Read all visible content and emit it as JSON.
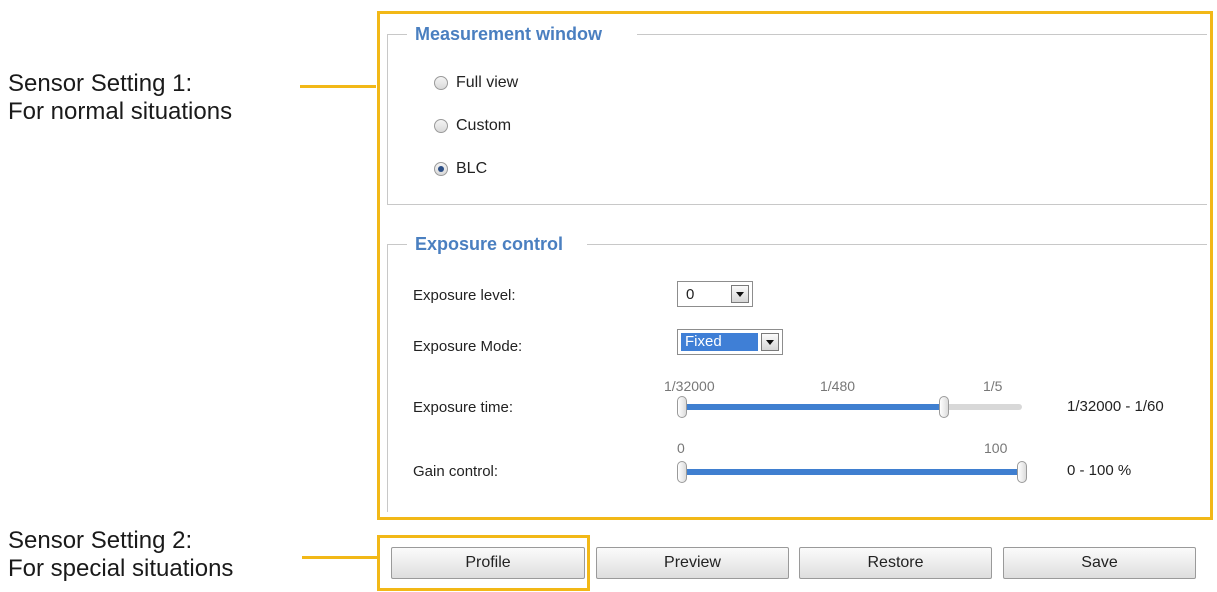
{
  "annotations": {
    "setting1_line1": "Sensor Setting 1:",
    "setting1_line2": "For normal situations",
    "setting2_line1": "Sensor Setting 2:",
    "setting2_line2": "For special situations"
  },
  "measurement_window": {
    "title": "Measurement window",
    "options": [
      {
        "label": "Full view",
        "checked": false
      },
      {
        "label": "Custom",
        "checked": false
      },
      {
        "label": "BLC",
        "checked": true
      }
    ]
  },
  "exposure_control": {
    "title": "Exposure control",
    "exposure_level": {
      "label": "Exposure level:",
      "value": "0"
    },
    "exposure_mode": {
      "label": "Exposure Mode:",
      "value": "Fixed"
    },
    "exposure_time": {
      "label": "Exposure time:",
      "ticks": [
        "1/32000",
        "1/480",
        "1/5"
      ],
      "range_text": "1/32000 - 1/60",
      "low_fraction": 0.0,
      "high_fraction": 0.77
    },
    "gain_control": {
      "label": "Gain control:",
      "ticks": [
        "0",
        "100"
      ],
      "range_text": "0 - 100 %",
      "low_value": 0,
      "high_value": 100
    }
  },
  "buttons": {
    "profile": "Profile",
    "preview": "Preview",
    "restore": "Restore",
    "save": "Save"
  },
  "colors": {
    "highlight": "#f2b817",
    "section_title": "#4a7fc0",
    "slider_fill": "#3f7fd0"
  }
}
